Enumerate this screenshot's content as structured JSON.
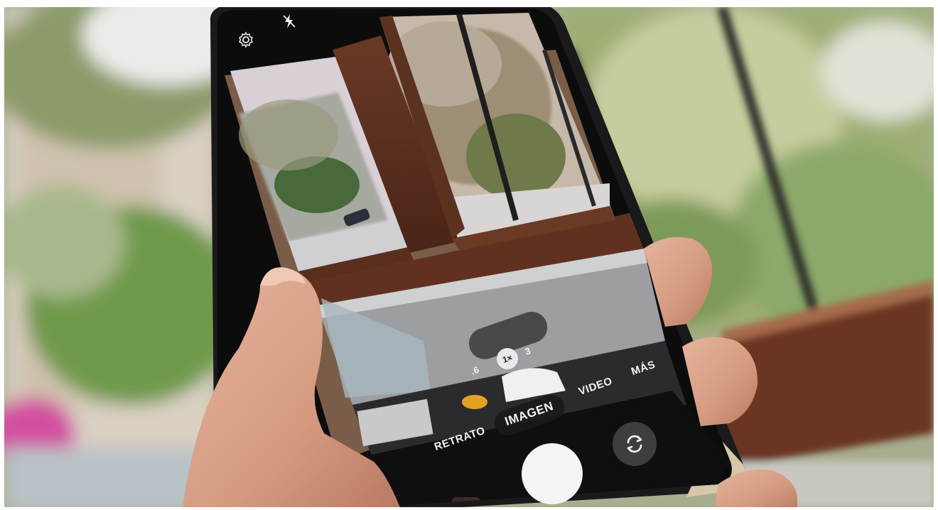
{
  "camera": {
    "zoom_options": [
      ".6",
      "1×",
      "3"
    ],
    "selected_zoom": "1×",
    "modes": [
      "RETRATO",
      "IMAGEN",
      "VIDEO",
      "MÁS"
    ],
    "selected_mode": "IMAGEN"
  },
  "icons": {
    "settings": "gear-icon",
    "flash": "flash-off-icon",
    "switch_camera": "switch-camera-icon",
    "shutter": "shutter-button"
  }
}
